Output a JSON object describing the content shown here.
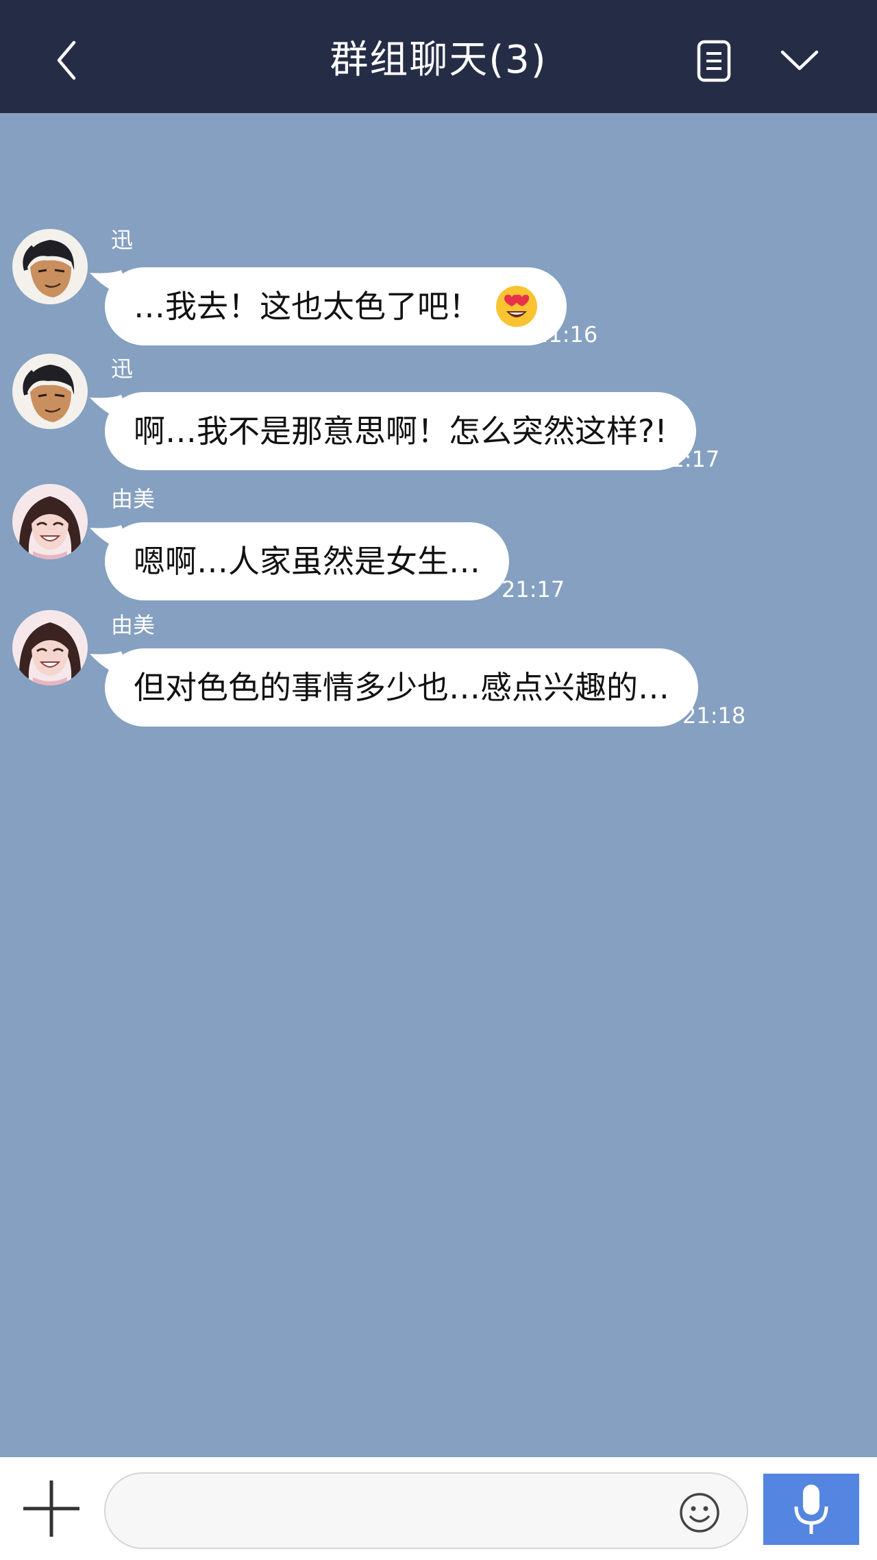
{
  "header": {
    "title": "群组聊天(3)",
    "colors": {
      "background": "#252d46",
      "text": "#ffffff"
    },
    "icons": {
      "back": "chevron-left-icon",
      "notes": "notes-icon",
      "expand": "chevron-down-icon"
    }
  },
  "chat": {
    "background": "#85a0c0",
    "messages": [
      {
        "sender": "迅",
        "text": "…我去！这也太色了吧！",
        "emoji": "heart-eyes-emoji",
        "time": "21:16"
      },
      {
        "sender": "迅",
        "text": "啊…我不是那意思啊！怎么突然这样?!",
        "time": "21:17"
      },
      {
        "sender": "由美",
        "text": "嗯啊…人家虽然是女生…",
        "time": "21:17"
      },
      {
        "sender": "由美",
        "text": "但对色色的事情多少也…感点兴趣的…",
        "time": "21:18"
      }
    ]
  },
  "bottom_bar": {
    "input_value": "",
    "icons": {
      "add": "plus-icon",
      "emoji": "smiley-icon",
      "voice": "microphone-icon"
    },
    "voice_button_color": "#5485e0"
  }
}
